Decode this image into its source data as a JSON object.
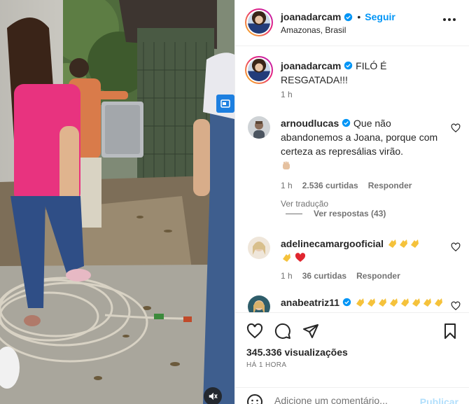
{
  "post": {
    "username": "joanadarcam",
    "follow_label": "Seguir",
    "location": "Amazonas, Brasil",
    "caption": "FILÓ É RESGATADA!!!",
    "caption_time": "1 h"
  },
  "comments": [
    {
      "username": "arnoudlucas",
      "text": "Que não abandonemos a Joana, porque com certeza as represálias virão.",
      "emoji": "raised-fist",
      "time": "1 h",
      "likes": "2.536 curtidas",
      "reply_label": "Responder",
      "translate_label": "Ver tradução"
    },
    {
      "username": "adelinecamargooficial",
      "emoji": "clapping-hands x4, red-heart",
      "time": "1 h",
      "likes": "36 curtidas",
      "reply_label": "Responder"
    },
    {
      "username": "anabeatriz11",
      "emoji": "clapping-hands x8"
    }
  ],
  "view_replies_label": "Ver respostas (43)",
  "stats": {
    "views": "345.336 visualizações",
    "posted": "HÁ 1 HORA"
  },
  "add_comment": {
    "placeholder": "Adicione um comentário...",
    "publish_label": "Publicar"
  },
  "colors": {
    "accent": "#0095f6",
    "verified": "#0095f6",
    "heart": "#ed4956",
    "shirt_pink": "#e8337f",
    "shirt_orange": "#d97b4a"
  }
}
